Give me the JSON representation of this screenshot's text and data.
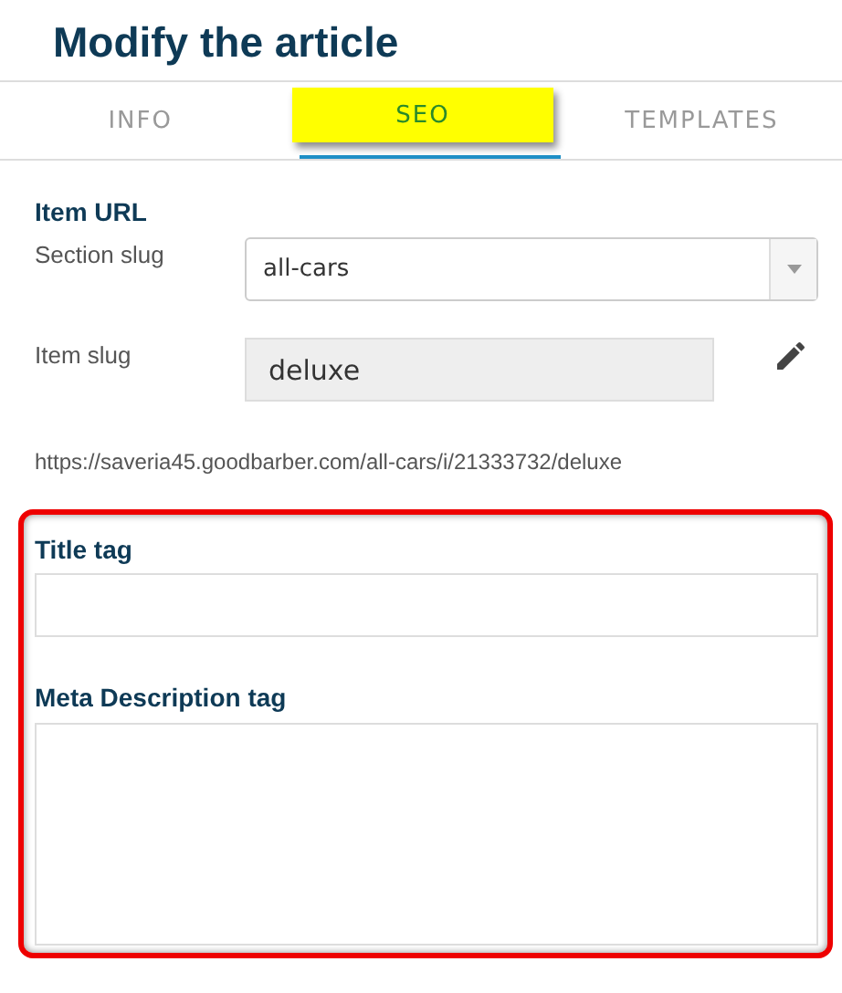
{
  "title": "Modify the article",
  "tabs": [
    {
      "label": "INFO",
      "selected": false
    },
    {
      "label": "SEO",
      "selected": true
    },
    {
      "label": "TEMPLATES",
      "selected": false
    }
  ],
  "item_url": {
    "heading": "Item URL",
    "section_slug": {
      "label": "Section slug",
      "value": "all-cars"
    },
    "item_slug": {
      "label": "Item slug",
      "value": "deluxe",
      "disabled": true
    },
    "url": "https://saveria45.goodbarber.com/all-cars/i/21333732/deluxe"
  },
  "seo_fields": {
    "highlighted": true,
    "title_tag": {
      "label": "Title tag"
    },
    "meta_description": {
      "label": "Meta Description tag"
    }
  }
}
